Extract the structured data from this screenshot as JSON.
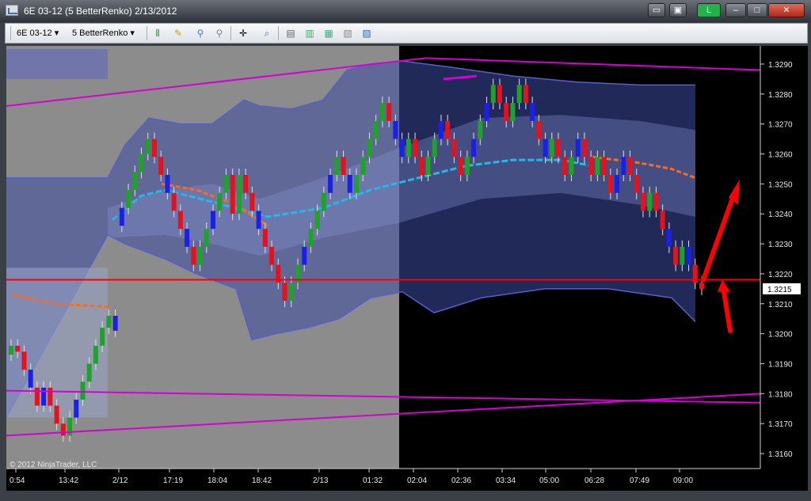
{
  "window": {
    "title": "6E 03-12 (5 BetterRenko)  2/13/2012",
    "indicator_label": "L",
    "colors": {
      "indicator": "#22b14c",
      "close": "#c42b1c"
    }
  },
  "toolbar": {
    "instrument": "6E 03-12",
    "bar_type": "5 BetterRenko",
    "icons": [
      "bar-style-icon",
      "pencil-icon",
      "pushpin-icon",
      "pin-gray-icon",
      "crosshair-icon",
      "zoom-icon",
      "data-box-icon",
      "indicators-icon",
      "strategies-icon",
      "properties-icon"
    ]
  },
  "chart": {
    "copyright": "© 2012 NinjaTrader, LLC",
    "last_price_label": "1.3215",
    "colors": {
      "background": "#000000",
      "session_gray": "#8c8c8c",
      "up_candle": "#1fa22a",
      "down_candle": "#e8101a",
      "renko_block": "#1a20e8",
      "channel_line": "#d400d4",
      "price_line": "#ff0000",
      "band_outer": "#5560c8",
      "ma_cyan": "#22b8e8",
      "ma_orange": "#ff6a1a",
      "arrow": "#ff0000"
    }
  },
  "chart_data": {
    "type": "candlestick",
    "instrument": "6E 03-12",
    "bar_type": "5 BetterRenko",
    "y_axis": {
      "ticks": [
        "1.3290",
        "1.3280",
        "1.3270",
        "1.3260",
        "1.3250",
        "1.3240",
        "1.3230",
        "1.3220",
        "1.3210",
        "1.3200",
        "1.3190",
        "1.3180",
        "1.3170",
        "1.3160"
      ],
      "range": [
        1.3155,
        1.3295
      ]
    },
    "x_axis": {
      "ticks": [
        "0:54",
        "13:42",
        "2/12",
        "17:19",
        "18:04",
        "18:42",
        "2/13",
        "01:32",
        "02:04",
        "02:36",
        "03:34",
        "05:00",
        "06:28",
        "07:49",
        "09:00"
      ]
    },
    "last_price": 1.3215,
    "horizontal_line": 1.3218,
    "grid": false,
    "legend": "none",
    "annotation": "© 2012 NinjaTrader, LLC",
    "bars": [
      {
        "o": 1.3193,
        "c": 1.3196
      },
      {
        "o": 1.3196,
        "c": 1.3194
      },
      {
        "o": 1.3194,
        "c": 1.3188
      },
      {
        "o": 1.3188,
        "c": 1.3182
      },
      {
        "o": 1.3182,
        "c": 1.3176
      },
      {
        "o": 1.3176,
        "c": 1.3182
      },
      {
        "o": 1.3182,
        "c": 1.3176
      },
      {
        "o": 1.3176,
        "c": 1.317
      },
      {
        "o": 1.317,
        "c": 1.3166
      },
      {
        "o": 1.3166,
        "c": 1.3172
      },
      {
        "o": 1.3172,
        "c": 1.3178
      },
      {
        "o": 1.3178,
        "c": 1.3184
      },
      {
        "o": 1.3184,
        "c": 1.319
      },
      {
        "o": 1.319,
        "c": 1.3196
      },
      {
        "o": 1.3196,
        "c": 1.3202
      },
      {
        "o": 1.3202,
        "c": 1.3206
      },
      {
        "o": 1.3206,
        "c": 1.3201
      },
      {
        "o": 1.3236,
        "c": 1.3242
      },
      {
        "o": 1.3242,
        "c": 1.3248
      },
      {
        "o": 1.3248,
        "c": 1.3254
      },
      {
        "o": 1.3254,
        "c": 1.326
      },
      {
        "o": 1.326,
        "c": 1.3265
      },
      {
        "o": 1.3265,
        "c": 1.3259
      },
      {
        "o": 1.3259,
        "c": 1.3253
      },
      {
        "o": 1.3253,
        "c": 1.3247
      },
      {
        "o": 1.3247,
        "c": 1.3241
      },
      {
        "o": 1.3241,
        "c": 1.3235
      },
      {
        "o": 1.3235,
        "c": 1.3229
      },
      {
        "o": 1.3229,
        "c": 1.3223
      },
      {
        "o": 1.3223,
        "c": 1.3229
      },
      {
        "o": 1.3229,
        "c": 1.3235
      },
      {
        "o": 1.3235,
        "c": 1.3241
      },
      {
        "o": 1.3241,
        "c": 1.3247
      },
      {
        "o": 1.3247,
        "c": 1.3253
      },
      {
        "o": 1.3253,
        "c": 1.324
      },
      {
        "o": 1.324,
        "c": 1.3253
      },
      {
        "o": 1.3253,
        "c": 1.3247
      },
      {
        "o": 1.3247,
        "c": 1.3241
      },
      {
        "o": 1.3241,
        "c": 1.3235
      },
      {
        "o": 1.3235,
        "c": 1.3229
      },
      {
        "o": 1.3229,
        "c": 1.3223
      },
      {
        "o": 1.3223,
        "c": 1.3217
      },
      {
        "o": 1.3217,
        "c": 1.3211
      },
      {
        "o": 1.3211,
        "c": 1.3217
      },
      {
        "o": 1.3217,
        "c": 1.3223
      },
      {
        "o": 1.3223,
        "c": 1.3229
      },
      {
        "o": 1.3229,
        "c": 1.3235
      },
      {
        "o": 1.3235,
        "c": 1.3241
      },
      {
        "o": 1.3241,
        "c": 1.3247
      },
      {
        "o": 1.3247,
        "c": 1.3253
      },
      {
        "o": 1.3253,
        "c": 1.3259
      },
      {
        "o": 1.3259,
        "c": 1.3253
      },
      {
        "o": 1.3253,
        "c": 1.3247
      },
      {
        "o": 1.3247,
        "c": 1.3253
      },
      {
        "o": 1.3253,
        "c": 1.3259
      },
      {
        "o": 1.3259,
        "c": 1.3265
      },
      {
        "o": 1.3265,
        "c": 1.3271
      },
      {
        "o": 1.3271,
        "c": 1.3277
      },
      {
        "o": 1.3277,
        "c": 1.3271
      },
      {
        "o": 1.3271,
        "c": 1.3265
      },
      {
        "o": 1.3265,
        "c": 1.3259
      },
      {
        "o": 1.3259,
        "c": 1.3265
      },
      {
        "o": 1.3265,
        "c": 1.3259
      },
      {
        "o": 1.3259,
        "c": 1.3253
      },
      {
        "o": 1.3253,
        "c": 1.3259
      },
      {
        "o": 1.3259,
        "c": 1.3265
      },
      {
        "o": 1.3265,
        "c": 1.3271
      },
      {
        "o": 1.3271,
        "c": 1.3265
      },
      {
        "o": 1.3265,
        "c": 1.3259
      },
      {
        "o": 1.3259,
        "c": 1.3253
      },
      {
        "o": 1.3253,
        "c": 1.3259
      },
      {
        "o": 1.3259,
        "c": 1.3265
      },
      {
        "o": 1.3265,
        "c": 1.3271
      },
      {
        "o": 1.3271,
        "c": 1.3277
      },
      {
        "o": 1.3277,
        "c": 1.3283
      },
      {
        "o": 1.3283,
        "c": 1.3277
      },
      {
        "o": 1.3277,
        "c": 1.3271
      },
      {
        "o": 1.3271,
        "c": 1.3277
      },
      {
        "o": 1.3277,
        "c": 1.3283
      },
      {
        "o": 1.3283,
        "c": 1.3277
      },
      {
        "o": 1.3277,
        "c": 1.3271
      },
      {
        "o": 1.3271,
        "c": 1.3265
      },
      {
        "o": 1.3265,
        "c": 1.3259
      },
      {
        "o": 1.3259,
        "c": 1.3265
      },
      {
        "o": 1.3265,
        "c": 1.3259
      },
      {
        "o": 1.3259,
        "c": 1.3253
      },
      {
        "o": 1.3253,
        "c": 1.3259
      },
      {
        "o": 1.3259,
        "c": 1.3265
      },
      {
        "o": 1.3265,
        "c": 1.3259
      },
      {
        "o": 1.3259,
        "c": 1.3253
      },
      {
        "o": 1.3253,
        "c": 1.3259
      },
      {
        "o": 1.3259,
        "c": 1.3253
      },
      {
        "o": 1.3253,
        "c": 1.3247
      },
      {
        "o": 1.3247,
        "c": 1.3253
      },
      {
        "o": 1.3253,
        "c": 1.3259
      },
      {
        "o": 1.3259,
        "c": 1.3253
      },
      {
        "o": 1.3253,
        "c": 1.3247
      },
      {
        "o": 1.3247,
        "c": 1.3241
      },
      {
        "o": 1.3241,
        "c": 1.3247
      },
      {
        "o": 1.3247,
        "c": 1.3241
      },
      {
        "o": 1.3241,
        "c": 1.3235
      },
      {
        "o": 1.3235,
        "c": 1.3229
      },
      {
        "o": 1.3229,
        "c": 1.3223
      },
      {
        "o": 1.3223,
        "c": 1.3229
      },
      {
        "o": 1.3229,
        "c": 1.3223
      },
      {
        "o": 1.3223,
        "c": 1.3217
      },
      {
        "o": 1.3217,
        "c": 1.3215
      }
    ]
  }
}
